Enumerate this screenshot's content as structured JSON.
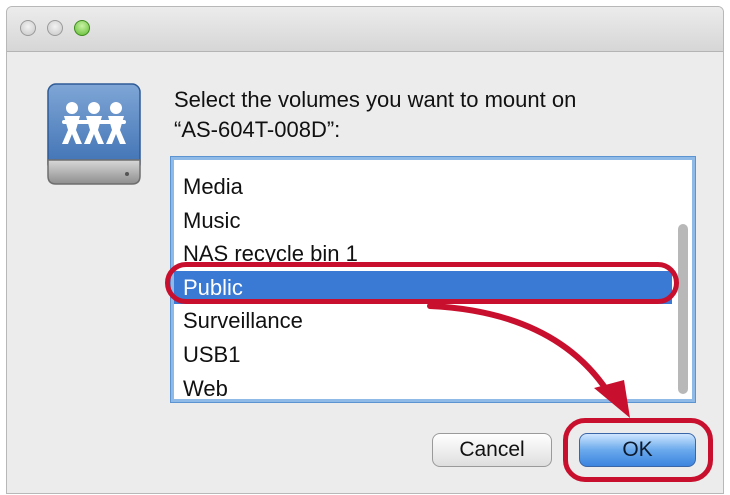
{
  "window": {
    "traffic_lights": [
      "close",
      "minimize",
      "zoom"
    ]
  },
  "dialog": {
    "icon": "network-drive-icon",
    "prompt_line1": "Select the volumes you want to mount on",
    "prompt_line2": "“AS-604T-008D”:"
  },
  "volumes": {
    "items": [
      {
        "label": "Media",
        "selected": false
      },
      {
        "label": "Music",
        "selected": false
      },
      {
        "label": "NAS recycle bin 1",
        "selected": false
      },
      {
        "label": "Public",
        "selected": true
      },
      {
        "label": "Surveillance",
        "selected": false
      },
      {
        "label": "USB1",
        "selected": false
      },
      {
        "label": "Web",
        "selected": false
      }
    ]
  },
  "buttons": {
    "cancel": "Cancel",
    "ok": "OK"
  },
  "colors": {
    "selection": "#3a7ad4",
    "annotation": "#c8102e",
    "default_button": "#3b84df"
  }
}
